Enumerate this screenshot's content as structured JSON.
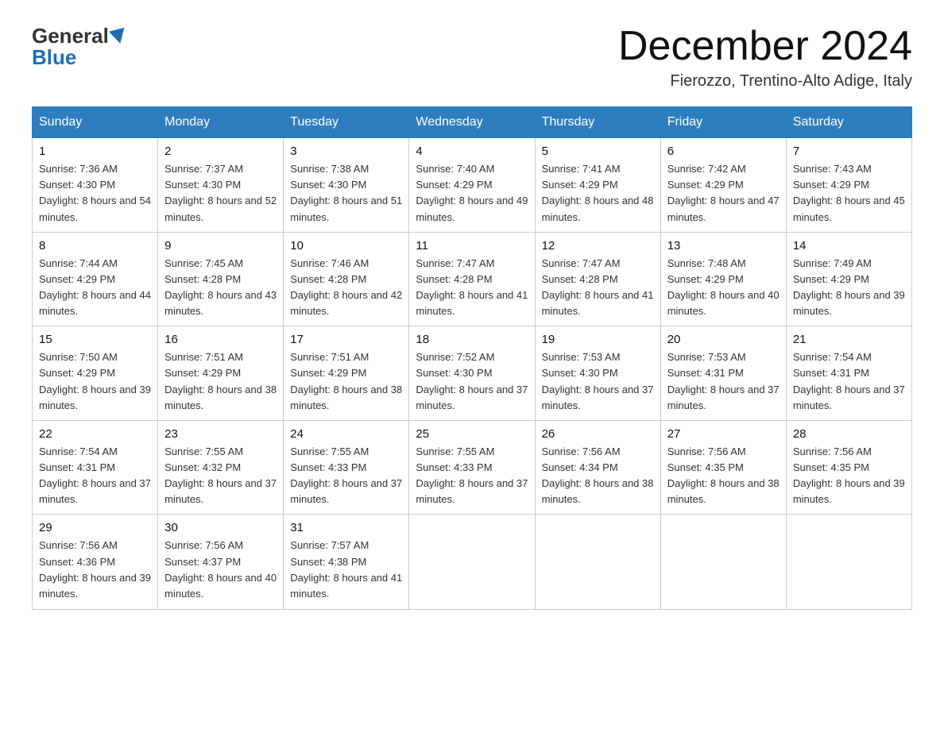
{
  "logo": {
    "general": "General",
    "blue": "Blue"
  },
  "header": {
    "month": "December 2024",
    "location": "Fierozzo, Trentino-Alto Adige, Italy"
  },
  "weekdays": [
    "Sunday",
    "Monday",
    "Tuesday",
    "Wednesday",
    "Thursday",
    "Friday",
    "Saturday"
  ],
  "weeks": [
    [
      {
        "day": "1",
        "sunrise": "7:36 AM",
        "sunset": "4:30 PM",
        "daylight": "8 hours and 54 minutes."
      },
      {
        "day": "2",
        "sunrise": "7:37 AM",
        "sunset": "4:30 PM",
        "daylight": "8 hours and 52 minutes."
      },
      {
        "day": "3",
        "sunrise": "7:38 AM",
        "sunset": "4:30 PM",
        "daylight": "8 hours and 51 minutes."
      },
      {
        "day": "4",
        "sunrise": "7:40 AM",
        "sunset": "4:29 PM",
        "daylight": "8 hours and 49 minutes."
      },
      {
        "day": "5",
        "sunrise": "7:41 AM",
        "sunset": "4:29 PM",
        "daylight": "8 hours and 48 minutes."
      },
      {
        "day": "6",
        "sunrise": "7:42 AM",
        "sunset": "4:29 PM",
        "daylight": "8 hours and 47 minutes."
      },
      {
        "day": "7",
        "sunrise": "7:43 AM",
        "sunset": "4:29 PM",
        "daylight": "8 hours and 45 minutes."
      }
    ],
    [
      {
        "day": "8",
        "sunrise": "7:44 AM",
        "sunset": "4:29 PM",
        "daylight": "8 hours and 44 minutes."
      },
      {
        "day": "9",
        "sunrise": "7:45 AM",
        "sunset": "4:28 PM",
        "daylight": "8 hours and 43 minutes."
      },
      {
        "day": "10",
        "sunrise": "7:46 AM",
        "sunset": "4:28 PM",
        "daylight": "8 hours and 42 minutes."
      },
      {
        "day": "11",
        "sunrise": "7:47 AM",
        "sunset": "4:28 PM",
        "daylight": "8 hours and 41 minutes."
      },
      {
        "day": "12",
        "sunrise": "7:47 AM",
        "sunset": "4:28 PM",
        "daylight": "8 hours and 41 minutes."
      },
      {
        "day": "13",
        "sunrise": "7:48 AM",
        "sunset": "4:29 PM",
        "daylight": "8 hours and 40 minutes."
      },
      {
        "day": "14",
        "sunrise": "7:49 AM",
        "sunset": "4:29 PM",
        "daylight": "8 hours and 39 minutes."
      }
    ],
    [
      {
        "day": "15",
        "sunrise": "7:50 AM",
        "sunset": "4:29 PM",
        "daylight": "8 hours and 39 minutes."
      },
      {
        "day": "16",
        "sunrise": "7:51 AM",
        "sunset": "4:29 PM",
        "daylight": "8 hours and 38 minutes."
      },
      {
        "day": "17",
        "sunrise": "7:51 AM",
        "sunset": "4:29 PM",
        "daylight": "8 hours and 38 minutes."
      },
      {
        "day": "18",
        "sunrise": "7:52 AM",
        "sunset": "4:30 PM",
        "daylight": "8 hours and 37 minutes."
      },
      {
        "day": "19",
        "sunrise": "7:53 AM",
        "sunset": "4:30 PM",
        "daylight": "8 hours and 37 minutes."
      },
      {
        "day": "20",
        "sunrise": "7:53 AM",
        "sunset": "4:31 PM",
        "daylight": "8 hours and 37 minutes."
      },
      {
        "day": "21",
        "sunrise": "7:54 AM",
        "sunset": "4:31 PM",
        "daylight": "8 hours and 37 minutes."
      }
    ],
    [
      {
        "day": "22",
        "sunrise": "7:54 AM",
        "sunset": "4:31 PM",
        "daylight": "8 hours and 37 minutes."
      },
      {
        "day": "23",
        "sunrise": "7:55 AM",
        "sunset": "4:32 PM",
        "daylight": "8 hours and 37 minutes."
      },
      {
        "day": "24",
        "sunrise": "7:55 AM",
        "sunset": "4:33 PM",
        "daylight": "8 hours and 37 minutes."
      },
      {
        "day": "25",
        "sunrise": "7:55 AM",
        "sunset": "4:33 PM",
        "daylight": "8 hours and 37 minutes."
      },
      {
        "day": "26",
        "sunrise": "7:56 AM",
        "sunset": "4:34 PM",
        "daylight": "8 hours and 38 minutes."
      },
      {
        "day": "27",
        "sunrise": "7:56 AM",
        "sunset": "4:35 PM",
        "daylight": "8 hours and 38 minutes."
      },
      {
        "day": "28",
        "sunrise": "7:56 AM",
        "sunset": "4:35 PM",
        "daylight": "8 hours and 39 minutes."
      }
    ],
    [
      {
        "day": "29",
        "sunrise": "7:56 AM",
        "sunset": "4:36 PM",
        "daylight": "8 hours and 39 minutes."
      },
      {
        "day": "30",
        "sunrise": "7:56 AM",
        "sunset": "4:37 PM",
        "daylight": "8 hours and 40 minutes."
      },
      {
        "day": "31",
        "sunrise": "7:57 AM",
        "sunset": "4:38 PM",
        "daylight": "8 hours and 41 minutes."
      },
      null,
      null,
      null,
      null
    ]
  ]
}
